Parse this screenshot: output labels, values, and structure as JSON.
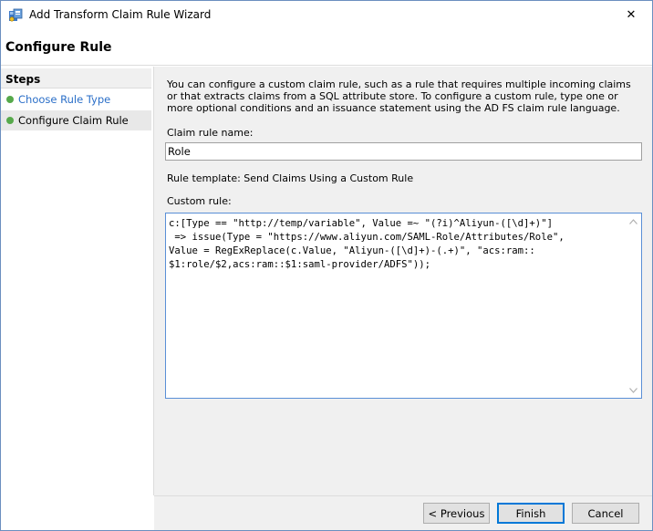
{
  "window": {
    "title": "Add Transform Claim Rule Wizard",
    "close_symbol": "✕"
  },
  "header": {
    "title": "Configure Rule"
  },
  "sidebar": {
    "title": "Steps",
    "items": [
      {
        "label": "Choose Rule Type",
        "state": "completed"
      },
      {
        "label": "Configure Claim Rule",
        "state": "current"
      }
    ]
  },
  "main": {
    "description": "You can configure a custom claim rule, such as a rule that requires multiple incoming claims or that extracts claims from a SQL attribute store. To configure a custom rule, type one or more optional conditions and an issuance statement using the AD FS claim rule language.",
    "claim_rule_name_label": "Claim rule name:",
    "claim_rule_name_value": "Role",
    "rule_template_text": "Rule template: Send Claims Using a Custom Rule",
    "custom_rule_label": "Custom rule:",
    "custom_rule_value": "c:[Type == \"http://temp/variable\", Value =~ \"(?i)^Aliyun-([\\d]+)\"]\n => issue(Type = \"https://www.aliyun.com/SAML-Role/Attributes/Role\",\nValue = RegExReplace(c.Value, \"Aliyun-([\\d]+)-(.+)\", \"acs:ram::\n$1:role/$2,acs:ram::$1:saml-provider/ADFS\"));"
  },
  "footer": {
    "previous_label": "< Previous",
    "finish_label": "Finish",
    "cancel_label": "Cancel"
  },
  "colors": {
    "step_dot": "#56a94b",
    "link": "#2b6fc8",
    "focus_border": "#5a8fd6",
    "default_button_border": "#0078d7"
  },
  "icons": {
    "title": "adfs-wizard-icon",
    "close": "close-icon",
    "scroll_up": "scroll-up-arrow-icon",
    "scroll_down": "scroll-down-arrow-icon"
  }
}
